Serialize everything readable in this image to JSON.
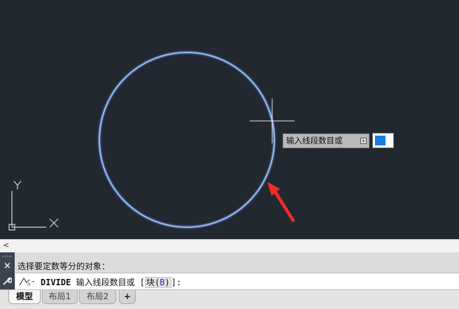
{
  "canvas": {
    "background": "#212830",
    "circle_color": "#8fb6ff",
    "ucs": {
      "y_label": "Y",
      "x_label": "X"
    },
    "dynamic_input": {
      "prompt": "输入线段数目或",
      "expand_icon": "plus-box-icon",
      "value": ""
    },
    "annotation_arrow_color": "#ee2b2b"
  },
  "scrollbar": {
    "left_arrow": "<"
  },
  "command_line": {
    "history": "选择要定数等分的对象：",
    "prompt_command": "DIVIDE",
    "prompt_text": " 输入线段数目或 [",
    "option_label": "块",
    "option_open": "(",
    "option_key": "B",
    "option_close": ")",
    "prompt_end": "]:",
    "close_icon": "×",
    "settings_icon": "🔧"
  },
  "tabs": [
    {
      "label": "模型",
      "active": true
    },
    {
      "label": "布局1",
      "active": false
    },
    {
      "label": "布局2",
      "active": false
    },
    {
      "label": "+",
      "active": false
    }
  ]
}
